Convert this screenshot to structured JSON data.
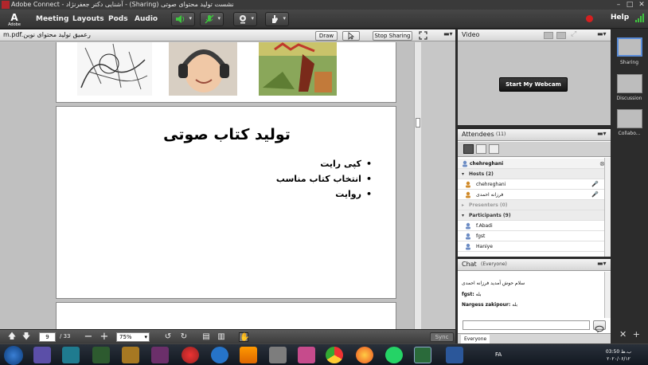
{
  "window": {
    "title": "Adobe Connect - آشنایی دکتر جعفرنژاد - (Sharing) نشست تولید محتوای صوتی",
    "logo_text": "A",
    "logo_sub": "Adobe"
  },
  "menubar": {
    "items": [
      "Meeting",
      "Layouts",
      "Pods",
      "Audio"
    ],
    "help": "Help"
  },
  "share_pod": {
    "file_name": "m.pdf.رعمیق تولید محتوای نوین",
    "draw_label": "Draw",
    "stop_sharing_label": "Stop Sharing",
    "slide": {
      "title": "تولید کتاب صوتی",
      "bullets": [
        "کپی رایت",
        "انتخاب کتاب مناسب",
        "روایت"
      ]
    },
    "footer": {
      "page": "9",
      "total": "/ 33",
      "zoom": "75%",
      "sync_label": "Sync"
    }
  },
  "video_pod": {
    "title": "Video",
    "webcam_label": "Start My Webcam"
  },
  "attendees_pod": {
    "title": "Attendees",
    "count": "(11)",
    "me": "chehreghani",
    "hosts_label": "Hosts (2)",
    "hosts": [
      "chehreghani",
      "فرزانه احمدی"
    ],
    "presenters_label": "Presenters (0)",
    "participants_label": "Participants (9)",
    "participants": [
      "f.Abadi",
      "fgst",
      "Haniye"
    ]
  },
  "chat_pod": {
    "title": "Chat",
    "scope": "(Everyone)",
    "messages": [
      {
        "sender": "",
        "text": "سلام حوش آمدید فرزانه احمدی"
      },
      {
        "sender": "fgst:",
        "text": "بله"
      },
      {
        "sender": "Nargess zakipour:",
        "text": "بله"
      }
    ],
    "tab_label": "Everyone"
  },
  "layouts": {
    "items": [
      "Sharing",
      "Discussion",
      "Collabo..."
    ]
  },
  "taskbar": {
    "lang": "FA",
    "time": "03:50 ب.ظ",
    "date": "۲۰۲۰/۰۶/۱۲"
  },
  "colors": {
    "accent_blue": "#5a8cd8",
    "record_red": "#d42020",
    "toolbar_dark": "#333333"
  }
}
